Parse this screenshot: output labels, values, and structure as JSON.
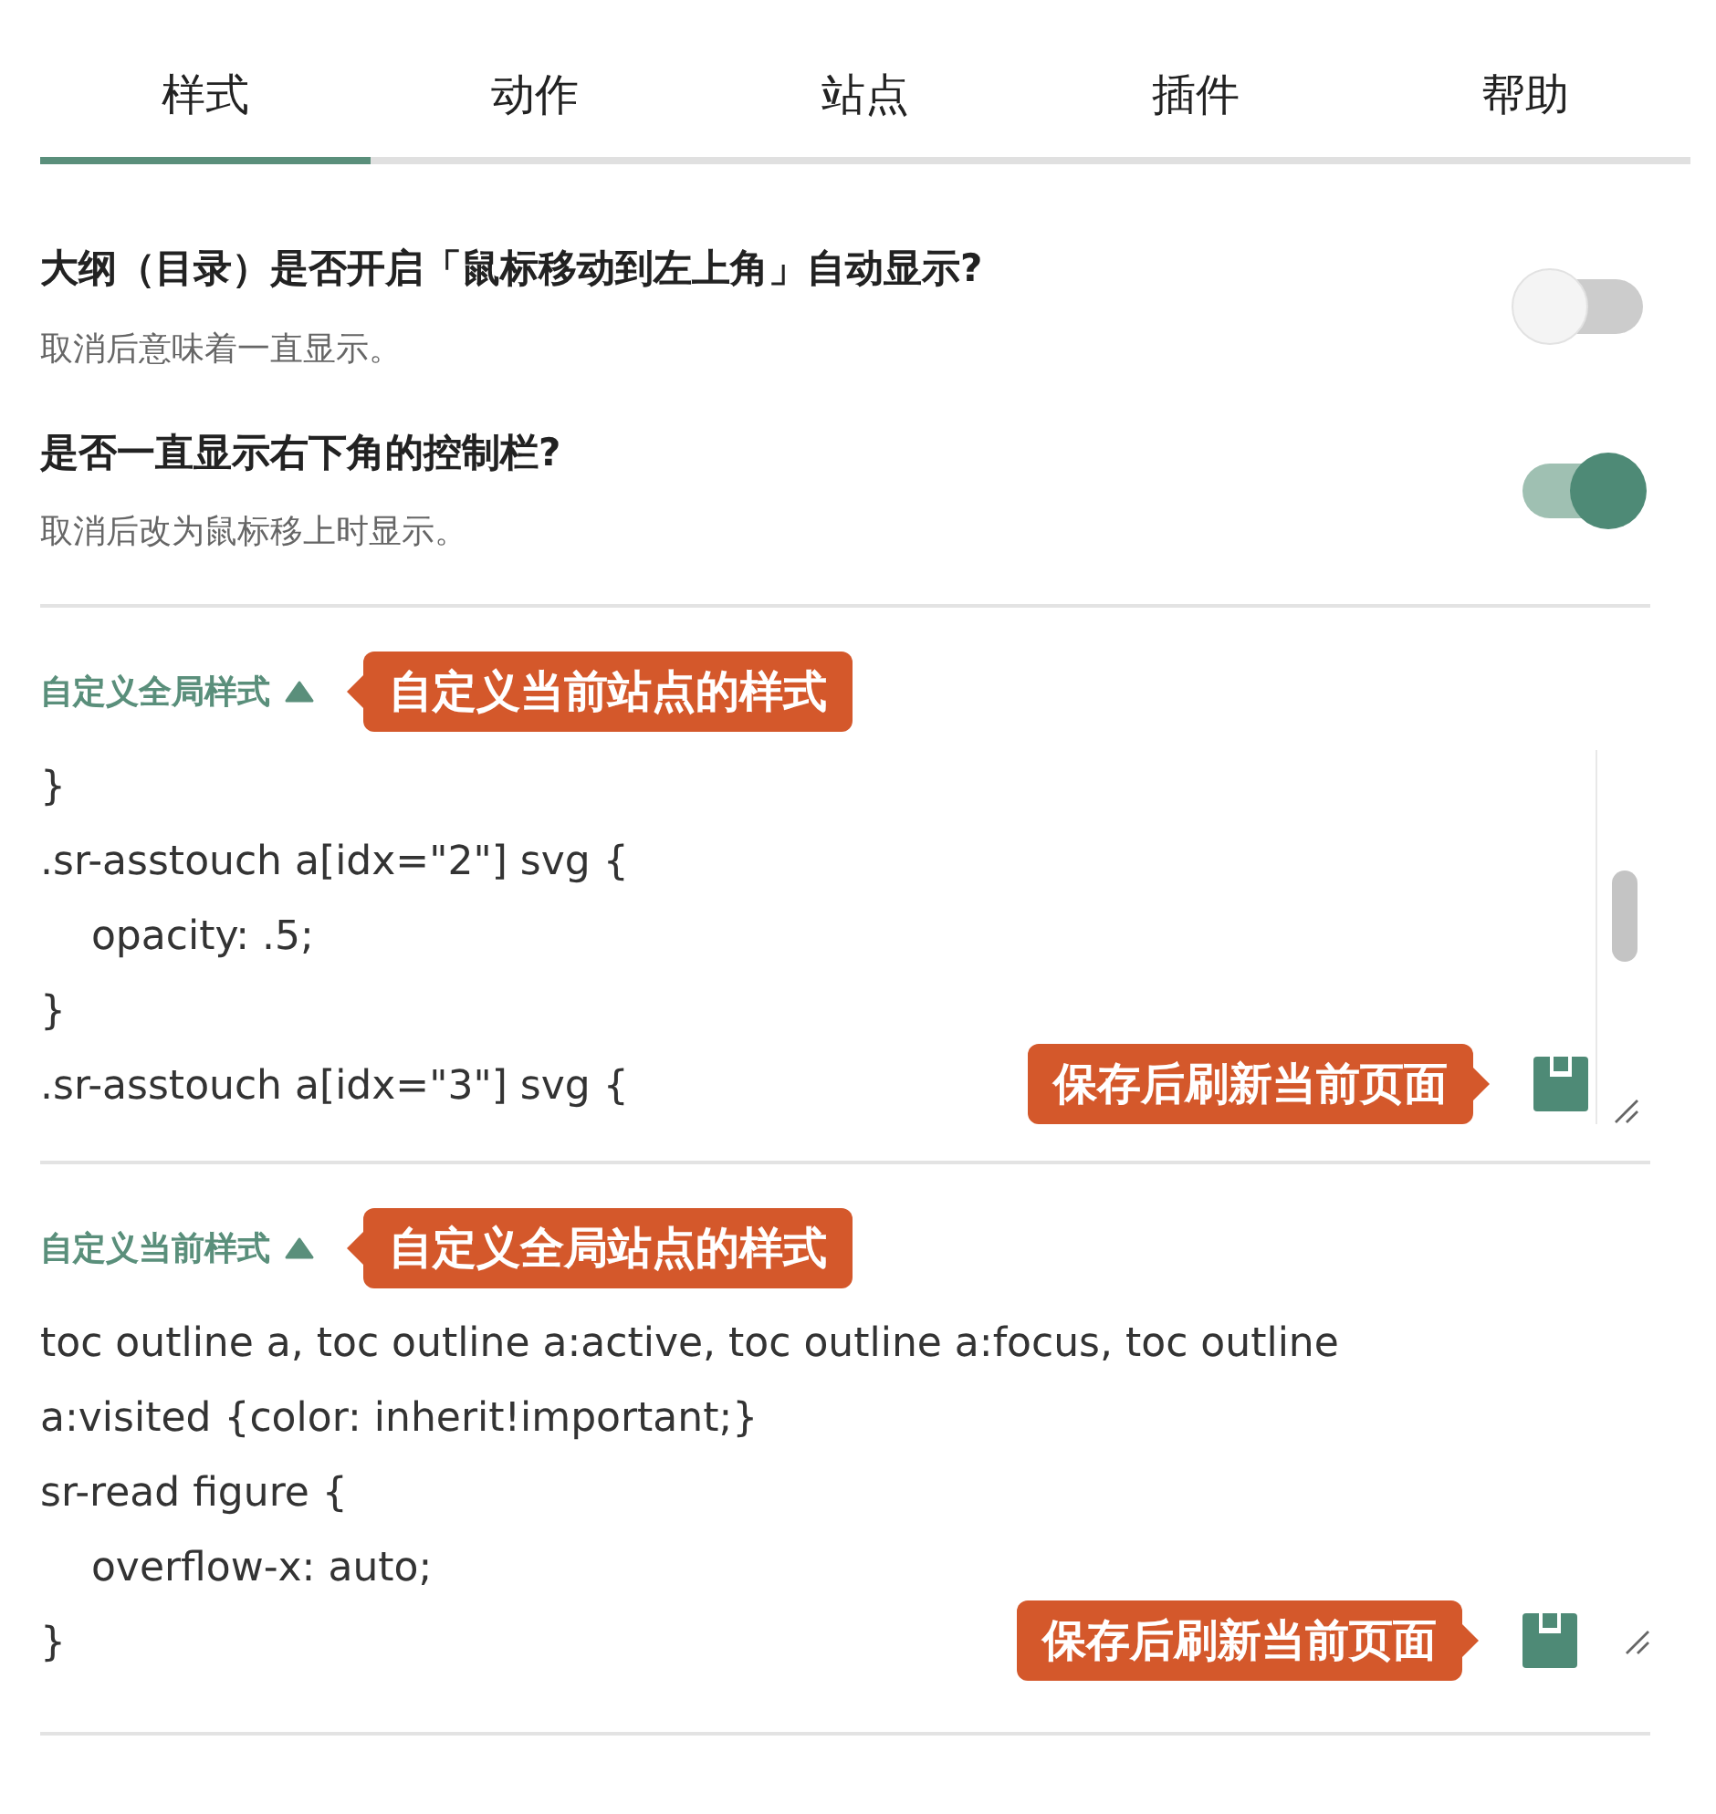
{
  "tabs": [
    {
      "label": "样式",
      "selected": true
    },
    {
      "label": "动作",
      "selected": false
    },
    {
      "label": "站点",
      "selected": false
    },
    {
      "label": "插件",
      "selected": false
    },
    {
      "label": "帮助",
      "selected": false
    }
  ],
  "settings": [
    {
      "title": "大纲（目录）是否开启「鼠标移动到左上角」自动显示?",
      "description": "取消后意味着一直显示。",
      "on": false
    },
    {
      "title": "是否一直显示右下角的控制栏?",
      "description": "取消后改为鼠标移上时显示。",
      "on": true
    }
  ],
  "editors": [
    {
      "label": "自定义全局样式",
      "tooltip": "自定义当前站点的样式",
      "code_lines": [
        "}",
        ".sr-asstouch a[idx=\"2\"] svg {",
        "    opacity: .5;",
        "}",
        ".sr-asstouch a[idx=\"3\"] svg {"
      ],
      "save_tooltip": "保存后刷新当前页面",
      "scrollbar": true
    },
    {
      "label": "自定义当前样式",
      "tooltip": "自定义全局站点的样式",
      "code_lines": [
        "toc outline a, toc outline a:active, toc outline a:focus, toc outline",
        "a:visited {color: inherit!important;}",
        "sr-read figure {",
        "    overflow-x: auto;",
        "}"
      ],
      "save_tooltip": "保存后刷新当前页面",
      "scrollbar": false
    }
  ]
}
